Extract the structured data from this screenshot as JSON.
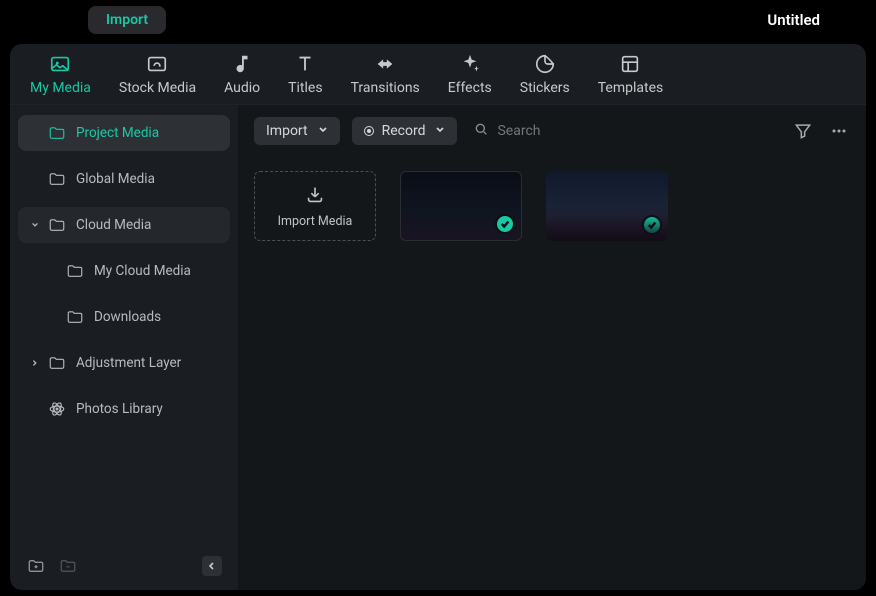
{
  "header": {
    "import_pill": "Import",
    "project_title": "Untitled"
  },
  "tabs": [
    {
      "key": "my-media",
      "label": "My Media",
      "active": true
    },
    {
      "key": "stock-media",
      "label": "Stock Media"
    },
    {
      "key": "audio",
      "label": "Audio"
    },
    {
      "key": "titles",
      "label": "Titles"
    },
    {
      "key": "transitions",
      "label": "Transitions"
    },
    {
      "key": "effects",
      "label": "Effects"
    },
    {
      "key": "stickers",
      "label": "Stickers"
    },
    {
      "key": "templates",
      "label": "Templates"
    }
  ],
  "sidebar": {
    "items": [
      {
        "label": "Project Media"
      },
      {
        "label": "Global Media"
      },
      {
        "label": "Cloud Media"
      },
      {
        "label": "My Cloud Media"
      },
      {
        "label": "Downloads"
      },
      {
        "label": "Adjustment Layer"
      },
      {
        "label": "Photos Library"
      }
    ]
  },
  "toolbar": {
    "import_label": "Import",
    "record_label": "Record",
    "search_placeholder": "Search"
  },
  "grid": {
    "import_tile_label": "Import Media"
  },
  "colors": {
    "accent": "#17c9a4"
  }
}
